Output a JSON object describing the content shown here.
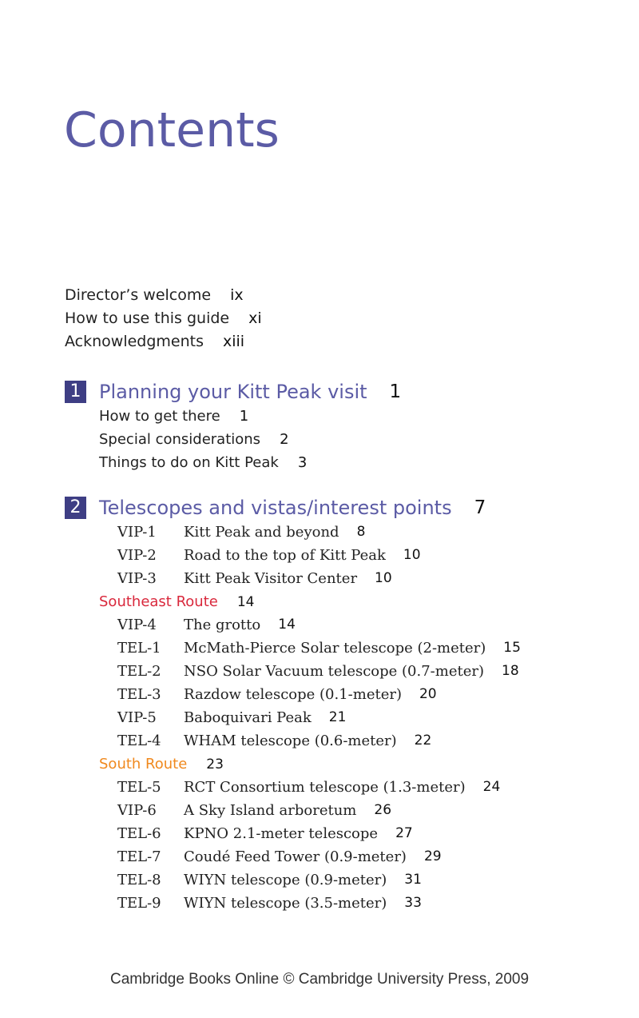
{
  "page_title": "Contents",
  "front_matter": [
    {
      "label": "Director’s welcome",
      "page": "ix"
    },
    {
      "label": "How to use this guide",
      "page": "xi"
    },
    {
      "label": "Acknowledgments",
      "page": "xiii"
    }
  ],
  "chapters": [
    {
      "number": "1",
      "title": "Planning your Kitt Peak visit",
      "page": "1",
      "sections": [
        {
          "label": "How to get there",
          "page": "1"
        },
        {
          "label": "Special considerations",
          "page": "2"
        },
        {
          "label": "Things to do on Kitt Peak",
          "page": "3"
        }
      ]
    },
    {
      "number": "2",
      "title": "Telescopes and vistas/interest points",
      "page": "7",
      "entries": [
        {
          "code": "VIP-1",
          "label": "Kitt Peak and beyond",
          "page": "8"
        },
        {
          "code": "VIP-2",
          "label": "Road to the top of Kitt Peak",
          "page": "10"
        },
        {
          "code": "VIP-3",
          "label": "Kitt Peak Visitor Center",
          "page": "10"
        }
      ],
      "routes": [
        {
          "name": "Southeast Route",
          "page": "14",
          "color": "#d9283c",
          "entries": [
            {
              "code": "VIP-4",
              "label": "The grotto",
              "page": "14"
            },
            {
              "code": "TEL-1",
              "label": "McMath-Pierce Solar telescope (2-meter)",
              "page": "15"
            },
            {
              "code": "TEL-2",
              "label": "NSO Solar Vacuum telescope (0.7-meter)",
              "page": "18"
            },
            {
              "code": "TEL-3",
              "label": "Razdow telescope (0.1-meter)",
              "page": "20"
            },
            {
              "code": "VIP-5",
              "label": "Baboquivari Peak",
              "page": "21"
            },
            {
              "code": "TEL-4",
              "label": "WHAM telescope (0.6-meter)",
              "page": "22"
            }
          ]
        },
        {
          "name": "South Route",
          "page": "23",
          "color": "#f0891e",
          "entries": [
            {
              "code": "TEL-5",
              "label": "RCT Consortium telescope (1.3-meter)",
              "page": "24"
            },
            {
              "code": "VIP-6",
              "label": "A Sky Island arboretum",
              "page": "26"
            },
            {
              "code": "TEL-6",
              "label": "KPNO 2.1-meter telescope",
              "page": "27"
            },
            {
              "code": "TEL-7",
              "label": "Coudé Feed Tower (0.9-meter)",
              "page": "29"
            },
            {
              "code": "TEL-8",
              "label": "WIYN telescope (0.9-meter)",
              "page": "31"
            },
            {
              "code": "TEL-9",
              "label": "WIYN telescope (3.5-meter)",
              "page": "33"
            }
          ]
        }
      ]
    }
  ],
  "colors": {
    "title": "#5b5ba5",
    "chapter_badge": "#3e3e84"
  },
  "footer": "Cambridge Books Online © Cambridge University Press, 2009"
}
